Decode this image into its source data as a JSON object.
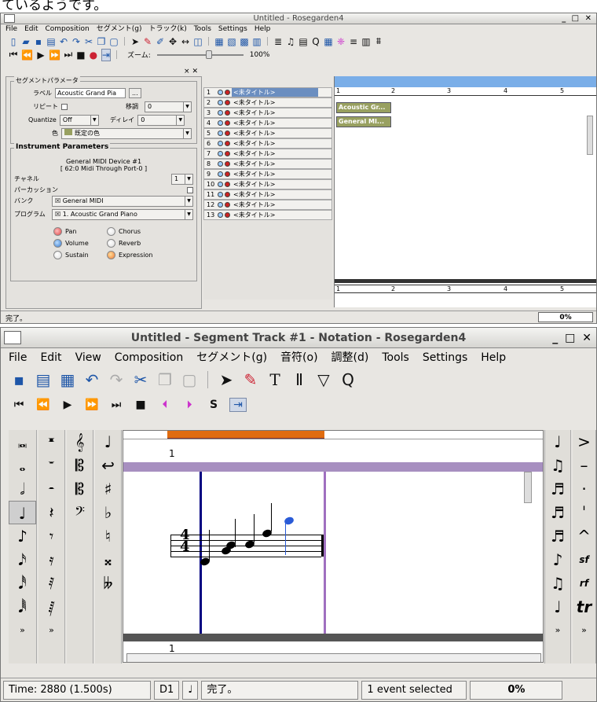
{
  "cut_caption": "ているようです。",
  "w1": {
    "title": "Untitled - Rosegarden4",
    "menus": [
      "File",
      "Edit",
      "Composition",
      "セグメント(g)",
      "トラック(k)",
      "Tools",
      "Settings",
      "Help"
    ],
    "zoom_label": "ズーム:",
    "zoom_value": "100%",
    "seg_params": {
      "title": "セグメントパラメータ",
      "label_lbl": "ラベル",
      "label_val": "Acoustic Grand Pia",
      "label_btn": "...",
      "repeat_lbl": "リピート",
      "transpose_lbl": "移調",
      "transpose_val": "0",
      "quantize_lbl": "Quantize",
      "quantize_val": "Off",
      "delay_lbl": "ディレイ",
      "delay_val": "0",
      "color_lbl": "色",
      "color_val": "既定の色"
    },
    "inst": {
      "title": "Instrument Parameters",
      "device": "General MIDI Device #1",
      "port": "[ 62:0 Midi Through Port-0 ]",
      "channel_lbl": "チャネル",
      "channel_val": "1",
      "perc_lbl": "パーカッション",
      "bank_lbl": "バンク",
      "bank_val": "General MIDI",
      "program_lbl": "プログラム",
      "program_val": "1. Acoustic Grand Piano",
      "knobs": [
        "Pan",
        "Chorus",
        "Volume",
        "Reverb",
        "Sustain",
        "Expression"
      ]
    },
    "tracks": [
      {
        "num": "1",
        "name": "<未タイトル>"
      },
      {
        "num": "2",
        "name": "<未タイトル>"
      },
      {
        "num": "3",
        "name": "<未タイトル>"
      },
      {
        "num": "4",
        "name": "<未タイトル>"
      },
      {
        "num": "5",
        "name": "<未タイトル>"
      },
      {
        "num": "6",
        "name": "<未タイトル>"
      },
      {
        "num": "7",
        "name": "<未タイトル>"
      },
      {
        "num": "8",
        "name": "<未タイトル>"
      },
      {
        "num": "9",
        "name": "<未タイトル>"
      },
      {
        "num": "10",
        "name": "<未タイトル>"
      },
      {
        "num": "11",
        "name": "<未タイトル>"
      },
      {
        "num": "12",
        "name": "<未タイトル>"
      },
      {
        "num": "13",
        "name": "<未タイトル>"
      }
    ],
    "bars": [
      "1",
      "2",
      "3",
      "4",
      "5"
    ],
    "segments": [
      "Acoustic Gr...",
      "General MI..."
    ],
    "status": "完了。",
    "progress": "0%"
  },
  "w2": {
    "title": "Untitled - Segment Track #1 - Notation - Rosegarden4",
    "menus": [
      "File",
      "Edit",
      "View",
      "Composition",
      "セグメント(g)",
      "音符(o)",
      "調整(d)",
      "Tools",
      "Settings",
      "Help"
    ],
    "bar_num": "1",
    "status": {
      "time": "Time: 2880 (1.500s)",
      "pitch": "D1",
      "msg": "完了。",
      "sel": "1 event selected",
      "pct": "0%"
    }
  },
  "colors": {
    "accent": "#7aaee8",
    "segment": "#98a060",
    "selection": "#2a5bd7",
    "bar_line": "#000080",
    "purple": "#a070c0",
    "orange": "#e06c10"
  }
}
